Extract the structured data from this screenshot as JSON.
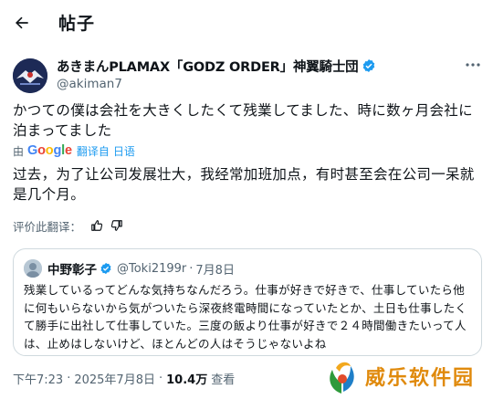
{
  "header": {
    "title": "帖子"
  },
  "author": {
    "name": "あきまんPLAMAX「GODZ ORDER」神翼騎士団",
    "handle": "@akiman7"
  },
  "post": {
    "original_text": "かつての僕は会社を大きくしたくて残業してました、時に数ヶ月会社に泊まってました",
    "translation_prefix": "由",
    "google_word": "Google",
    "translate_link": "翻译自",
    "source_language": "日语",
    "translated_text": "过去，为了让公司发展壮大，我经常加班加点，有时甚至会在公司一呆就是几个月。",
    "rate_label": "评价此翻译："
  },
  "quote": {
    "name": "中野彰子",
    "handle": "@Toki2199r",
    "dot": "·",
    "date": "7月8日",
    "text": "残業しているってどんな気持ちなんだろう。仕事が好きで好きで、仕事していたら他に何もいらないから気がついたら深夜終電時間になっていたとか、土日も仕事したくて勝手に出社して仕事していた。三度の飯より仕事が好きで２４時間働きたいって人は、止めはしないけど、ほとんどの人はそうじゃないよね"
  },
  "meta": {
    "time": "下午7:23",
    "dot1": "·",
    "date": "2025年7月8日",
    "dot2": "·",
    "views": "10.4万",
    "views_label": "查看"
  },
  "watermark": {
    "text": "威乐软件园"
  },
  "colors": {
    "link": "#1d9bf0",
    "secondary_text": "#536471",
    "verified": "#1d9bf0",
    "border": "#cfd9de",
    "watermark": "#e08a0c"
  },
  "icons": [
    "back-arrow-icon",
    "verified-badge-icon",
    "more-options-icon",
    "google-logo",
    "thumbs-up-icon",
    "thumbs-down-icon"
  ]
}
